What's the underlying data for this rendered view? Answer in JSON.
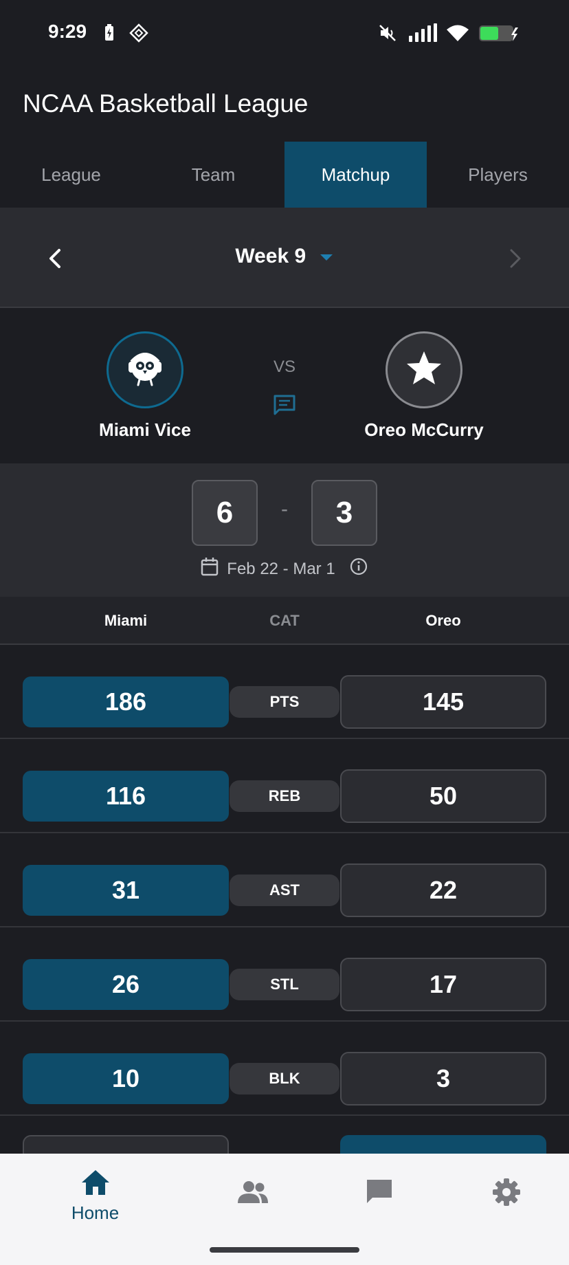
{
  "status_bar": {
    "time": "9:29"
  },
  "header": {
    "title": "NCAA Basketball League"
  },
  "tabs": [
    {
      "label": "League",
      "active": false
    },
    {
      "label": "Team",
      "active": false
    },
    {
      "label": "Matchup",
      "active": true
    },
    {
      "label": "Players",
      "active": false
    }
  ],
  "week": {
    "label": "Week 9"
  },
  "matchup": {
    "vs_label": "VS",
    "home_team": {
      "name": "Miami Vice",
      "avatar_icon": "owl-icon"
    },
    "away_team": {
      "name": "Oreo McCurry",
      "avatar_icon": "star-icon"
    },
    "home_score": "6",
    "score_separator": "-",
    "away_score": "3",
    "date_range": "Feb 22 - Mar 1"
  },
  "category_header": {
    "left": "Miami",
    "middle": "CAT",
    "right": "Oreo"
  },
  "stats": [
    {
      "cat": "PTS",
      "home": "186",
      "away": "145"
    },
    {
      "cat": "REB",
      "home": "116",
      "away": "50"
    },
    {
      "cat": "AST",
      "home": "31",
      "away": "22"
    },
    {
      "cat": "STL",
      "home": "26",
      "away": "17"
    },
    {
      "cat": "BLK",
      "home": "10",
      "away": "3"
    }
  ],
  "bottom_nav": [
    {
      "label": "Home",
      "icon": "home-icon",
      "active": true
    },
    {
      "label": "",
      "icon": "people-icon",
      "active": false
    },
    {
      "label": "",
      "icon": "chat-icon",
      "active": false
    },
    {
      "label": "",
      "icon": "gear-icon",
      "active": false
    }
  ],
  "colors": {
    "background": "#1c1d22",
    "accent": "#0e4c6a",
    "panel": "#2b2c31",
    "nav_background": "#f5f5f7"
  }
}
